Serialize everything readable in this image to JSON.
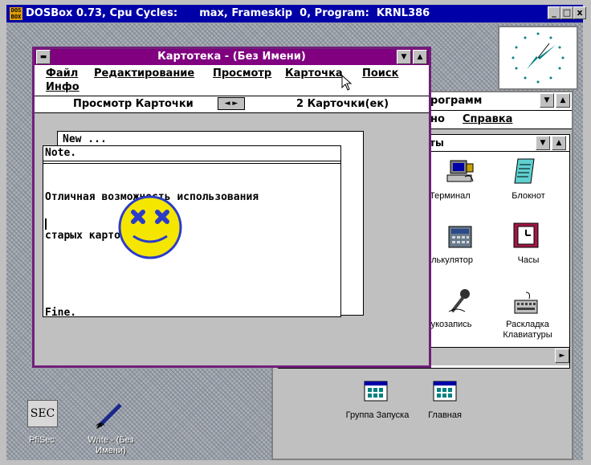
{
  "host": {
    "title": "DOSBox 0.73, Cpu Cycles:      max, Frameskip  0, Program:  KRNL386",
    "icon": "DOS\nBOX",
    "buttons": [
      "_",
      "□",
      "x"
    ]
  },
  "program_manager": {
    "title": "рограмм",
    "menu": [
      "но",
      "Справка"
    ],
    "group_title": "ты",
    "items": [
      {
        "label": "Терминал",
        "icon": "terminal-icon"
      },
      {
        "label": "Блокнот",
        "icon": "notepad-icon"
      },
      {
        "label": "алькулятор",
        "icon": "calculator-icon"
      },
      {
        "label": "Часы",
        "icon": "clock-icon"
      },
      {
        "label": "вукозапись",
        "icon": "sound-recorder-icon"
      },
      {
        "label": "Раскладка\nКлавиатуры",
        "icon": "keyboard-layout-icon"
      }
    ],
    "group_icons": [
      {
        "label": "Группа Запуска"
      },
      {
        "label": "Главная"
      }
    ]
  },
  "cardfile": {
    "title": "Картотека - (Без Имени)",
    "menu": {
      "row1": [
        "Файл",
        "Редактирование",
        "Просмотр",
        "Карточка",
        "Поиск"
      ],
      "row2": [
        "Инфо"
      ]
    },
    "toolbar": {
      "view": "Просмотр Карточки",
      "arrows": "◄ ►",
      "count": "2  Карточки(ек)"
    },
    "back_card_title": "New ...",
    "front_card_title": "Note.",
    "body_lines": [
      "Отличная возможность использования",
      "старых картотек.",
      "",
      "Fine."
    ]
  },
  "desktop_icons": [
    {
      "label": "PfiSec",
      "glyph": "SEC"
    },
    {
      "label": "Write - (Без\nИмени)"
    }
  ],
  "colors": {
    "titlebar_active": "#0000a8",
    "cardfile_title": "#800080",
    "smiley_face": "#f5e600",
    "smiley_eyes": "#2b3cc8"
  }
}
